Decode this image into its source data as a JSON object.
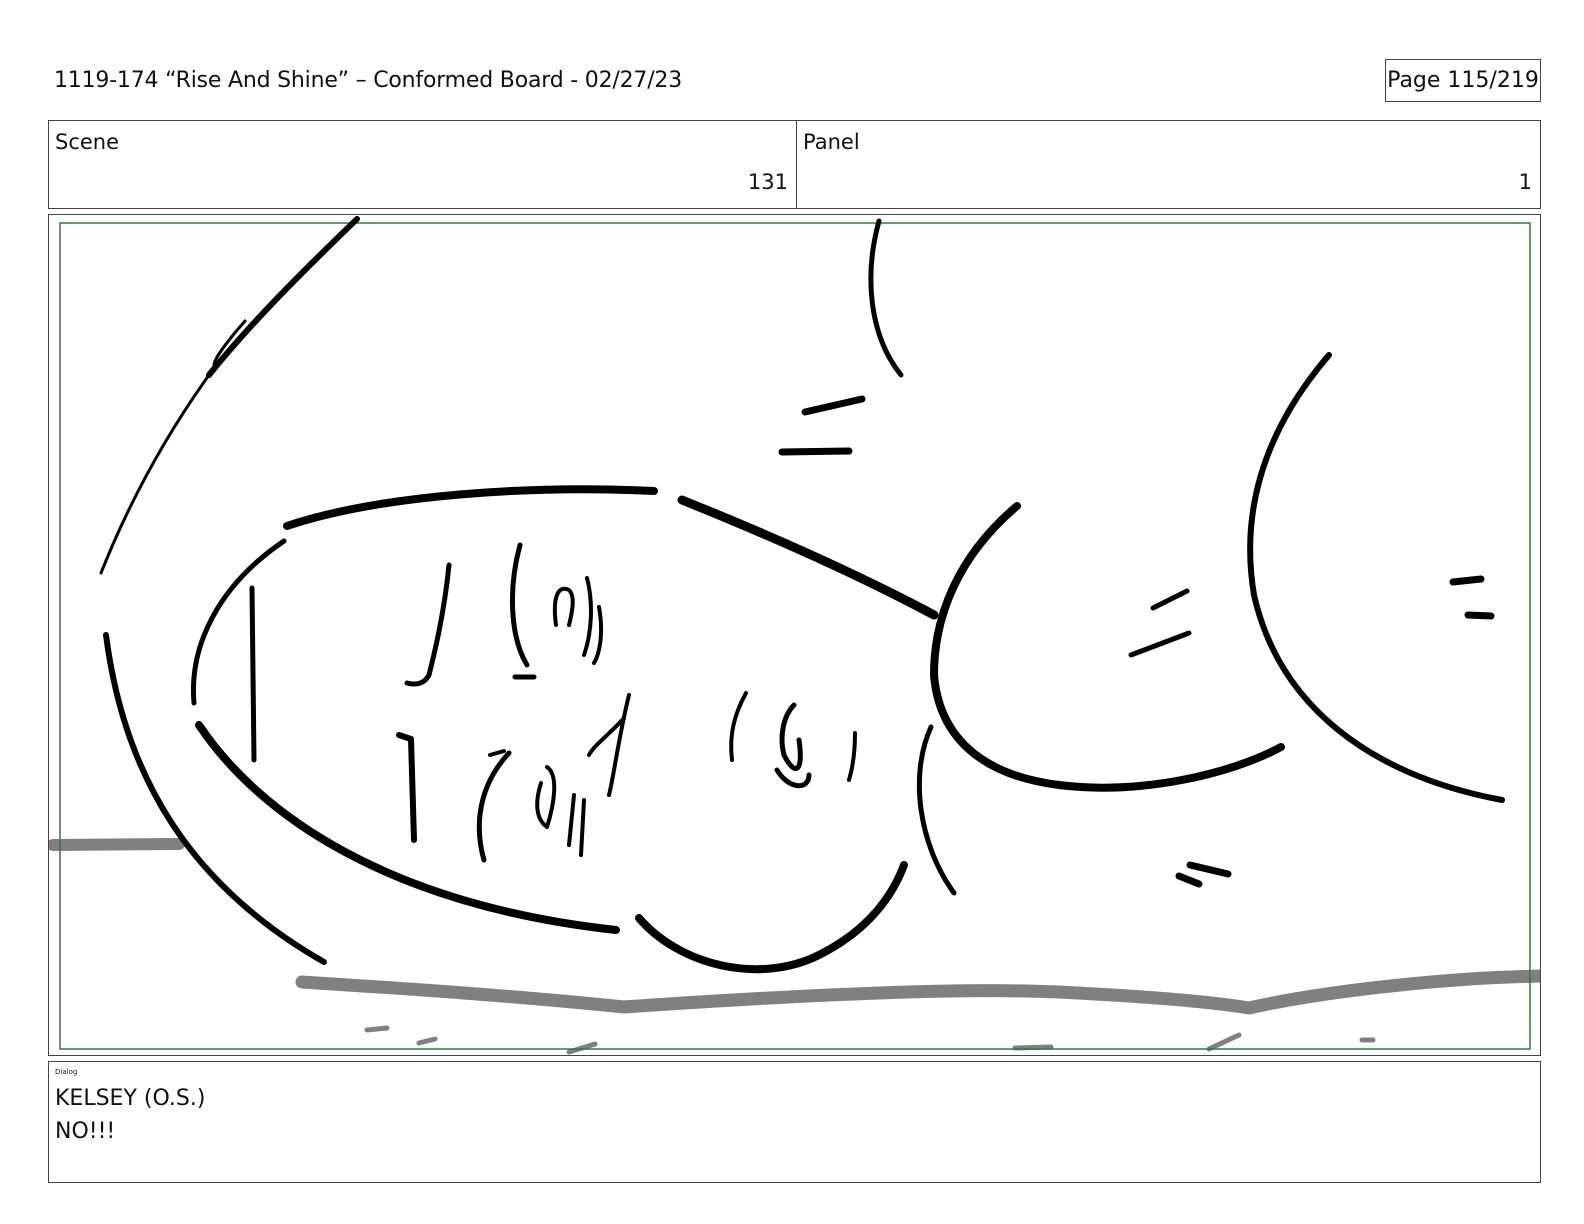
{
  "header": {
    "title": "1119-174 “Rise And Shine” – Conformed Board - 02/27/23",
    "page_label": "Page 115/219"
  },
  "info": {
    "scene_label": "Scene",
    "scene_value": "131",
    "panel_label": "Panel",
    "panel_value": "1"
  },
  "frame": {
    "safe_area_color": "#2e7d32",
    "sketch_color": "#000000",
    "shadow_color": "#808080"
  },
  "dialog": {
    "section_label": "Dialog",
    "lines": [
      "KELSEY (O.S.)",
      "NO!!!"
    ]
  }
}
